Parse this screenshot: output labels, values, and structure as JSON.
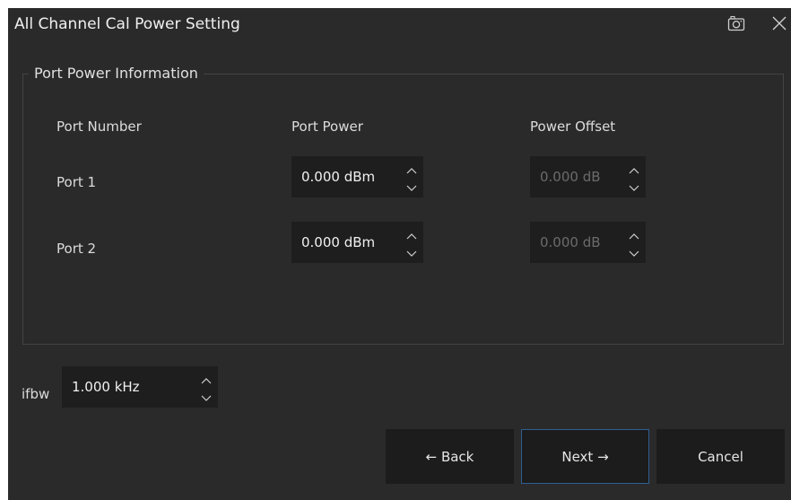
{
  "dialog": {
    "title": "All Channel Cal Power Setting",
    "camera_icon": "camera-icon",
    "close_icon": "close-icon"
  },
  "port_group": {
    "legend": "Port Power Information",
    "headers": {
      "port_number": "Port Number",
      "port_power": "Port Power",
      "power_offset": "Power Offset"
    },
    "rows": [
      {
        "port": "Port 1",
        "power": "0.000 dBm",
        "offset": "0.000 dB"
      },
      {
        "port": "Port 2",
        "power": "0.000 dBm",
        "offset": "0.000 dB"
      }
    ]
  },
  "ifbw": {
    "label": "ifbw",
    "value": "1.000 kHz"
  },
  "buttons": {
    "back": "← Back",
    "next": "Next →",
    "cancel": "Cancel"
  },
  "colors": {
    "background": "#2a2a2a",
    "field_bg": "#1e1e1e",
    "button_bg": "#1c1c1c",
    "primary_border": "#2f5f92",
    "disabled_text": "#6b6b6b"
  }
}
